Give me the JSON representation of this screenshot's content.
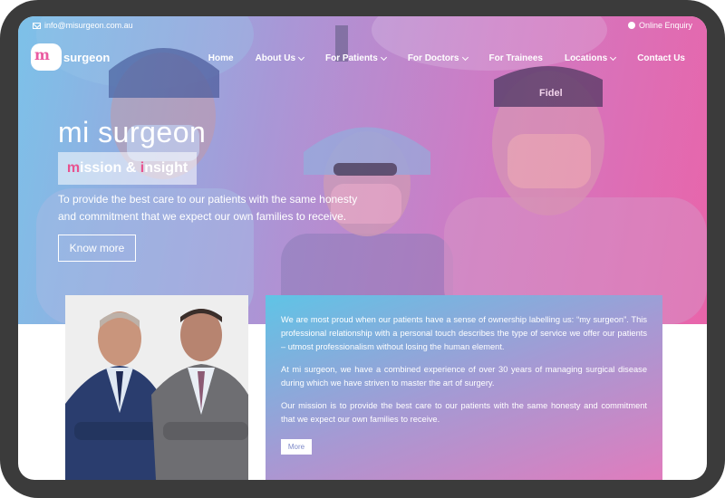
{
  "topbar": {
    "email": "info@misurgeon.com.au",
    "enquiry": "Online Enquiry"
  },
  "logo": {
    "mark": "m",
    "text": "surgeon"
  },
  "nav": [
    {
      "label": "Home",
      "dropdown": false
    },
    {
      "label": "About Us",
      "dropdown": true
    },
    {
      "label": "For Patients",
      "dropdown": true
    },
    {
      "label": "For Doctors",
      "dropdown": true
    },
    {
      "label": "For Trainees",
      "dropdown": false
    },
    {
      "label": "Locations",
      "dropdown": true
    },
    {
      "label": "Contact Us",
      "dropdown": false
    }
  ],
  "hero": {
    "title": "mi surgeon",
    "tagline_m": "m",
    "tagline_rest1": "ission & ",
    "tagline_i": "i",
    "tagline_rest2": "nsight",
    "description": "To provide the best care to our patients with the same honesty and commitment that we expect our own families to receive.",
    "button": "Know more"
  },
  "about": {
    "p1": "We are most proud when our patients have a sense of ownership labelling us: “my surgeon”. This professional relationship with a personal touch describes the type of service we offer our patients – utmost professionalism without losing the human element.",
    "p2": "At mi surgeon, we have a combined experience of over 30 years of managing surgical disease during which we have striven to master the art of surgery.",
    "p3": "Our mission is to provide the best care to our patients with the same honesty and commitment that we expect our own families to receive.",
    "button": "More"
  },
  "colors": {
    "accent_pink": "#e8528f",
    "gradient_blue": "#7fc3e8",
    "gradient_pink": "#ea6aaa"
  }
}
